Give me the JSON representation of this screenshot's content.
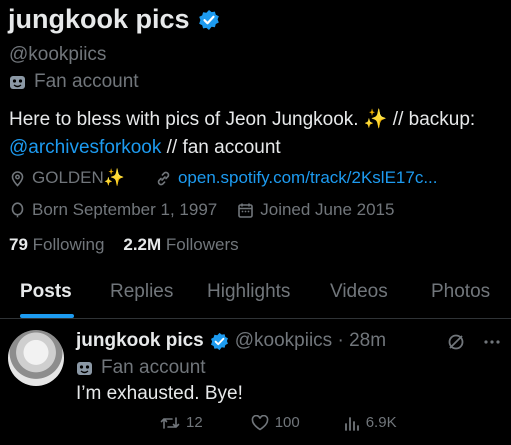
{
  "profile": {
    "display_name": "jungkook pics",
    "handle": "@kookpiics",
    "label": "Fan account",
    "bio_text": "Here to bless with pics of Jeon Jungkook. ✨ // backup:",
    "bio_link": "@archivesforkook",
    "bio_suffix": " // fan account",
    "location": "GOLDEN✨",
    "website": "open.spotify.com/track/2KslE17c...",
    "born": "Born September 1, 1997",
    "joined": "Joined June 2015",
    "following_count": "79",
    "following_label": "Following",
    "followers_count": "2.2M",
    "followers_label": "Followers"
  },
  "tabs": [
    "Posts",
    "Replies",
    "Highlights",
    "Videos",
    "Photos"
  ],
  "tweet": {
    "name": "jungkook pics",
    "handle_time": "@kookpiics · 28m",
    "label": "Fan account",
    "text": "I’m exhausted. Bye!",
    "retweets": "12",
    "likes": "100",
    "views": "6.9K"
  },
  "colors": {
    "accent": "#1d9bf0",
    "muted": "#71767b",
    "text": "#e7e9ea",
    "bg": "#000000"
  },
  "icons": [
    "verified-badge-icon",
    "mask-icon",
    "location-icon",
    "link-icon",
    "balloon-icon",
    "calendar-icon",
    "grok-icon",
    "more-icon",
    "retweet-icon",
    "like-icon",
    "views-icon"
  ]
}
